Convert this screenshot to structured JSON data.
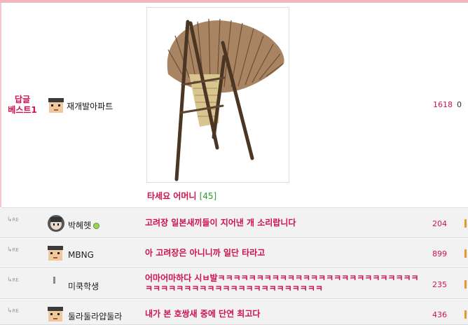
{
  "best": {
    "badge_line1": "답글",
    "badge_line2": "베스트1",
    "author": "재개발아파트",
    "image_alt": "straw back carrier",
    "title": "타세요 어머니",
    "comment_count": "[45]",
    "score": "1618",
    "zero": "0"
  },
  "re_label": "RE",
  "replies": [
    {
      "author": "박혜헷",
      "title": "고려장 일본새끼들이 지어낸 개 소리랍니다",
      "score": "204",
      "online": true
    },
    {
      "author": "MBNG",
      "title": "아 고려장은 아니니까 일단 타라고",
      "score": "899"
    },
    {
      "author": "미쿡학생",
      "title": "어마어마하다 시ㅂ발ㅋㅋㅋㅋㅋㅋㅋㅋㅋㅋㅋㅋㅋㅋㅋㅋㅋㅋㅋㅋㅋㅋㅋㅋㅋㅋㅋㅋㅋㅋㅋㅋㅋㅋㅋㅋㅋㅋㅋㅋㅋㅋㅋㅋㅋㅋㅋㅋㅋ",
      "score": "235"
    },
    {
      "author": "둘라둘라얍둘라",
      "title": "내가 본 호쌍새 중에 단연 최고다",
      "score": "436"
    }
  ],
  "colors": {
    "accent": "#d0114b",
    "count_green": "#2e9e2e",
    "row_bg": "#f2f2f2",
    "marker": "#e39a2d"
  }
}
